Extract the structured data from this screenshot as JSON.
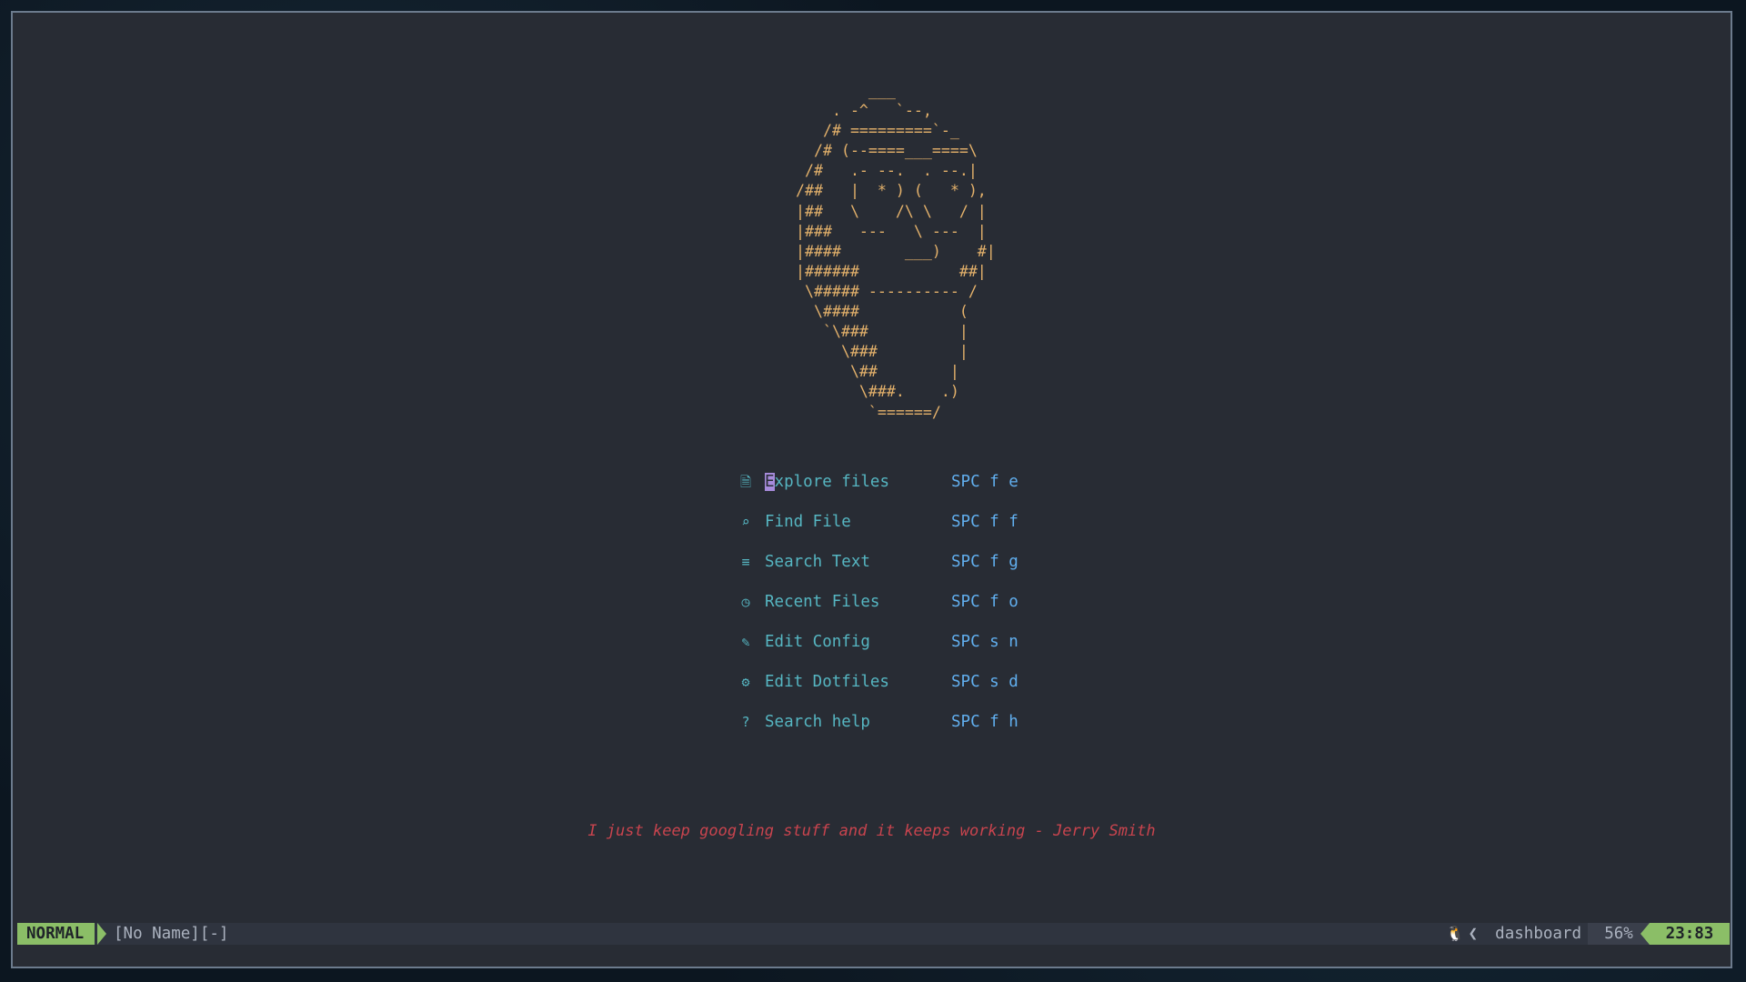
{
  "header_art": [
    "        ___",
    "    . -^   `--,",
    "   /# =========`-_",
    "  /# (--====___====\\",
    " /#   .- --.  . --.|",
    "/##   |  * ) (   * ),",
    "|##   \\    /\\ \\   / |",
    "|###   ---   \\ ---  |",
    "|####       ___)    #|",
    "|######           ##|",
    " \\##### ---------- /",
    "  \\####           (",
    "   `\\###          |",
    "     \\###         |",
    "      \\##        |",
    "       \\###.    .)",
    "        `======/"
  ],
  "menu": [
    {
      "icon": "file-icon",
      "glyph": "🗎",
      "cursor_char": "E",
      "label": "xplore files",
      "key": "SPC f e"
    },
    {
      "icon": "find-file-icon",
      "glyph": "⌕",
      "label": "Find File",
      "key": "SPC f f"
    },
    {
      "icon": "search-text-icon",
      "glyph": "≡",
      "label": "Search Text",
      "key": "SPC f g"
    },
    {
      "icon": "clock-icon",
      "glyph": "◷",
      "label": "Recent Files",
      "key": "SPC f o"
    },
    {
      "icon": "edit-config-icon",
      "glyph": "✎",
      "label": "Edit Config",
      "key": "SPC s n"
    },
    {
      "icon": "gear-icon",
      "glyph": "⚙",
      "label": "Edit Dotfiles",
      "key": "SPC s d"
    },
    {
      "icon": "help-icon",
      "glyph": "?",
      "label": "Search help",
      "key": "SPC f h"
    }
  ],
  "footer": {
    "quote": "I just keep googling stuff and it keeps working - Jerry Smith"
  },
  "statusline": {
    "mode": "NORMAL",
    "file": "[No Name][-]",
    "os_icon": "linux-icon",
    "filetype": "dashboard",
    "percent": "56%",
    "position": "23:83"
  },
  "colors": {
    "background": "#282c34",
    "ascii_art": "#e5b26b",
    "menu_text": "#56b6c2",
    "menu_key": "#61afef",
    "quote": "#c8444e",
    "mode_badge": "#8bbe67"
  }
}
